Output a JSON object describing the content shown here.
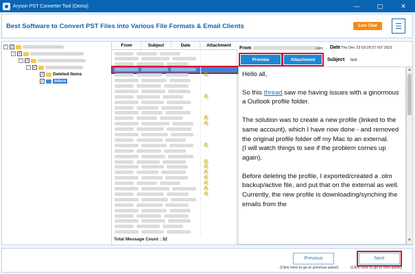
{
  "window": {
    "title": "Aryson PST Converter Tool (Demo)",
    "minimize": "—",
    "maximize": "▢",
    "close": "✕"
  },
  "header": {
    "title": "Best Software to Convert PST Files into Various File Formats & Email Clients",
    "live_chat": "Live Chat",
    "menu_icon": "☰"
  },
  "tree": {
    "deleted_items": "Deleted Items",
    "inbox": "Inbox"
  },
  "message_list": {
    "columns": [
      "From",
      "Subject",
      "Date",
      "Attachment"
    ],
    "total_count_label": "Total Message Count : 32",
    "attachment_rows": [
      4,
      8,
      12,
      13,
      17,
      20,
      21,
      22,
      23,
      24,
      25,
      26,
      35,
      36,
      39
    ],
    "selected_row": 3
  },
  "preview": {
    "from_label": "From",
    "from_domain": ".com",
    "date_label": "Date",
    "date_value": "Thu Dec 23 03:29:27 IST 2021",
    "subject_label": "Subject",
    "subject_value": "test",
    "tab_preview": "Preview",
    "tab_attachment": "Attachment",
    "body": {
      "greeting": "Hello all,",
      "p1_pre": "So this ",
      "p1_link": "thread",
      "p1_post": " saw me having issues with a ginormous a Outlook profile folder.",
      "p2": "The solution was to create a new profile (linked to the same account), which I have now done - and removed the original profile folder off my Mac to an external.",
      "p2b": "(I will watch things to see if the problem comes up again).",
      "p3": "Before deleting the profile, I exported/created a .olm backup/active file, and put that on the external as well.",
      "p3b": "Currently, the new profile is downloading/synching the emails from the"
    }
  },
  "nav": {
    "previous": "Previous",
    "next": "Next",
    "previous_hint": "(Click here to go to previous panel)",
    "next_hint": "(Click here to go to next panel)"
  },
  "colors": {
    "titlebar": "#0a65b4",
    "accent": "#1e88d8",
    "highlight": "#d0112b",
    "live_chat": "#f28c17"
  }
}
